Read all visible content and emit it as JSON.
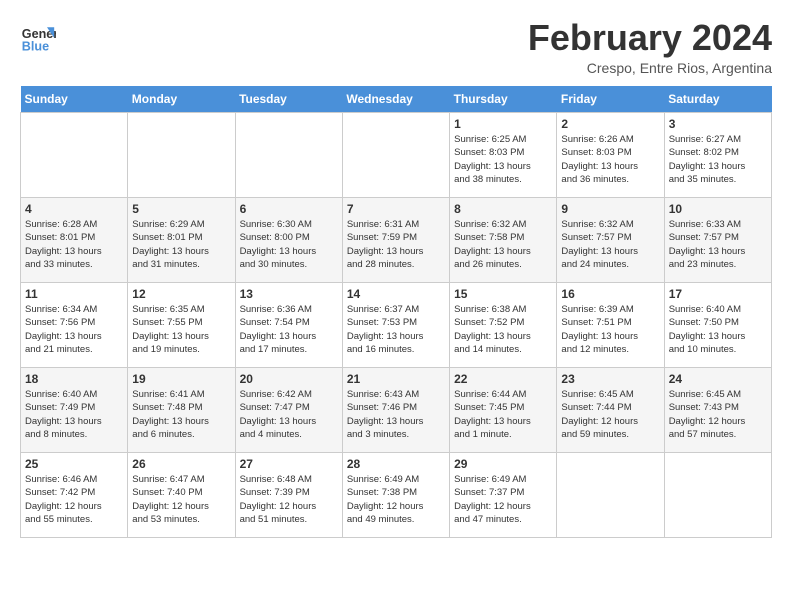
{
  "logo": {
    "line1": "General",
    "line2": "Blue"
  },
  "title": "February 2024",
  "subtitle": "Crespo, Entre Rios, Argentina",
  "days_of_week": [
    "Sunday",
    "Monday",
    "Tuesday",
    "Wednesday",
    "Thursday",
    "Friday",
    "Saturday"
  ],
  "weeks": [
    [
      {
        "day": "",
        "info": ""
      },
      {
        "day": "",
        "info": ""
      },
      {
        "day": "",
        "info": ""
      },
      {
        "day": "",
        "info": ""
      },
      {
        "day": "1",
        "info": "Sunrise: 6:25 AM\nSunset: 8:03 PM\nDaylight: 13 hours\nand 38 minutes."
      },
      {
        "day": "2",
        "info": "Sunrise: 6:26 AM\nSunset: 8:03 PM\nDaylight: 13 hours\nand 36 minutes."
      },
      {
        "day": "3",
        "info": "Sunrise: 6:27 AM\nSunset: 8:02 PM\nDaylight: 13 hours\nand 35 minutes."
      }
    ],
    [
      {
        "day": "4",
        "info": "Sunrise: 6:28 AM\nSunset: 8:01 PM\nDaylight: 13 hours\nand 33 minutes."
      },
      {
        "day": "5",
        "info": "Sunrise: 6:29 AM\nSunset: 8:01 PM\nDaylight: 13 hours\nand 31 minutes."
      },
      {
        "day": "6",
        "info": "Sunrise: 6:30 AM\nSunset: 8:00 PM\nDaylight: 13 hours\nand 30 minutes."
      },
      {
        "day": "7",
        "info": "Sunrise: 6:31 AM\nSunset: 7:59 PM\nDaylight: 13 hours\nand 28 minutes."
      },
      {
        "day": "8",
        "info": "Sunrise: 6:32 AM\nSunset: 7:58 PM\nDaylight: 13 hours\nand 26 minutes."
      },
      {
        "day": "9",
        "info": "Sunrise: 6:32 AM\nSunset: 7:57 PM\nDaylight: 13 hours\nand 24 minutes."
      },
      {
        "day": "10",
        "info": "Sunrise: 6:33 AM\nSunset: 7:57 PM\nDaylight: 13 hours\nand 23 minutes."
      }
    ],
    [
      {
        "day": "11",
        "info": "Sunrise: 6:34 AM\nSunset: 7:56 PM\nDaylight: 13 hours\nand 21 minutes."
      },
      {
        "day": "12",
        "info": "Sunrise: 6:35 AM\nSunset: 7:55 PM\nDaylight: 13 hours\nand 19 minutes."
      },
      {
        "day": "13",
        "info": "Sunrise: 6:36 AM\nSunset: 7:54 PM\nDaylight: 13 hours\nand 17 minutes."
      },
      {
        "day": "14",
        "info": "Sunrise: 6:37 AM\nSunset: 7:53 PM\nDaylight: 13 hours\nand 16 minutes."
      },
      {
        "day": "15",
        "info": "Sunrise: 6:38 AM\nSunset: 7:52 PM\nDaylight: 13 hours\nand 14 minutes."
      },
      {
        "day": "16",
        "info": "Sunrise: 6:39 AM\nSunset: 7:51 PM\nDaylight: 13 hours\nand 12 minutes."
      },
      {
        "day": "17",
        "info": "Sunrise: 6:40 AM\nSunset: 7:50 PM\nDaylight: 13 hours\nand 10 minutes."
      }
    ],
    [
      {
        "day": "18",
        "info": "Sunrise: 6:40 AM\nSunset: 7:49 PM\nDaylight: 13 hours\nand 8 minutes."
      },
      {
        "day": "19",
        "info": "Sunrise: 6:41 AM\nSunset: 7:48 PM\nDaylight: 13 hours\nand 6 minutes."
      },
      {
        "day": "20",
        "info": "Sunrise: 6:42 AM\nSunset: 7:47 PM\nDaylight: 13 hours\nand 4 minutes."
      },
      {
        "day": "21",
        "info": "Sunrise: 6:43 AM\nSunset: 7:46 PM\nDaylight: 13 hours\nand 3 minutes."
      },
      {
        "day": "22",
        "info": "Sunrise: 6:44 AM\nSunset: 7:45 PM\nDaylight: 13 hours\nand 1 minute."
      },
      {
        "day": "23",
        "info": "Sunrise: 6:45 AM\nSunset: 7:44 PM\nDaylight: 12 hours\nand 59 minutes."
      },
      {
        "day": "24",
        "info": "Sunrise: 6:45 AM\nSunset: 7:43 PM\nDaylight: 12 hours\nand 57 minutes."
      }
    ],
    [
      {
        "day": "25",
        "info": "Sunrise: 6:46 AM\nSunset: 7:42 PM\nDaylight: 12 hours\nand 55 minutes."
      },
      {
        "day": "26",
        "info": "Sunrise: 6:47 AM\nSunset: 7:40 PM\nDaylight: 12 hours\nand 53 minutes."
      },
      {
        "day": "27",
        "info": "Sunrise: 6:48 AM\nSunset: 7:39 PM\nDaylight: 12 hours\nand 51 minutes."
      },
      {
        "day": "28",
        "info": "Sunrise: 6:49 AM\nSunset: 7:38 PM\nDaylight: 12 hours\nand 49 minutes."
      },
      {
        "day": "29",
        "info": "Sunrise: 6:49 AM\nSunset: 7:37 PM\nDaylight: 12 hours\nand 47 minutes."
      },
      {
        "day": "",
        "info": ""
      },
      {
        "day": "",
        "info": ""
      }
    ]
  ]
}
